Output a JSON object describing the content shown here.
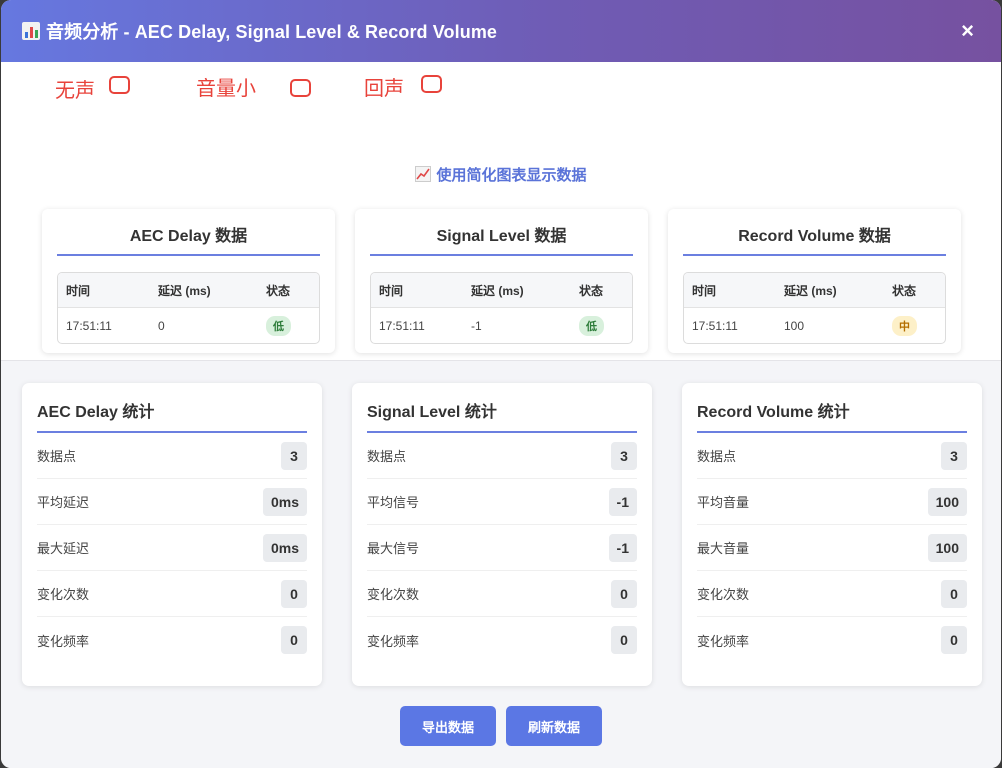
{
  "header": {
    "title": "音频分析 - AEC Delay, Signal Level & Record Volume",
    "close_glyph": "×"
  },
  "markers": [
    {
      "label": "无声"
    },
    {
      "label": "音量小"
    },
    {
      "label": "回声"
    }
  ],
  "simple_chart_link": "使用简化图表显示数据",
  "data_cards": [
    {
      "title": "AEC Delay 数据",
      "columns": [
        "时间",
        "延迟 (ms)",
        "状态"
      ],
      "rows": [
        {
          "time": "17:51:11",
          "value": "0",
          "status": "低",
          "status_level": "low"
        }
      ]
    },
    {
      "title": "Signal Level 数据",
      "columns": [
        "时间",
        "延迟 (ms)",
        "状态"
      ],
      "rows": [
        {
          "time": "17:51:11",
          "value": "-1",
          "status": "低",
          "status_level": "low"
        }
      ]
    },
    {
      "title": "Record Volume 数据",
      "columns": [
        "时间",
        "延迟 (ms)",
        "状态"
      ],
      "rows": [
        {
          "time": "17:51:11",
          "value": "100",
          "status": "中",
          "status_level": "mid"
        }
      ]
    }
  ],
  "stat_cards": [
    {
      "title": "AEC Delay 统计",
      "rows": [
        {
          "label": "数据点",
          "value": "3"
        },
        {
          "label": "平均延迟",
          "value": "0ms"
        },
        {
          "label": "最大延迟",
          "value": "0ms"
        },
        {
          "label": "变化次数",
          "value": "0"
        },
        {
          "label": "变化频率",
          "value": "0"
        }
      ]
    },
    {
      "title": "Signal Level 统计",
      "rows": [
        {
          "label": "数据点",
          "value": "3"
        },
        {
          "label": "平均信号",
          "value": "-1"
        },
        {
          "label": "最大信号",
          "value": "-1"
        },
        {
          "label": "变化次数",
          "value": "0"
        },
        {
          "label": "变化频率",
          "value": "0"
        }
      ]
    },
    {
      "title": "Record Volume 统计",
      "rows": [
        {
          "label": "数据点",
          "value": "3"
        },
        {
          "label": "平均音量",
          "value": "100"
        },
        {
          "label": "最大音量",
          "value": "100"
        },
        {
          "label": "变化次数",
          "value": "0"
        },
        {
          "label": "变化频率",
          "value": "0"
        }
      ]
    }
  ],
  "actions": {
    "export_label": "导出数据",
    "refresh_label": "刷新数据"
  },
  "colors": {
    "accent": "#5b77e4",
    "marker_red": "#e8433b",
    "status_low": "#d8f0dc",
    "status_mid": "#fdf0c8"
  }
}
